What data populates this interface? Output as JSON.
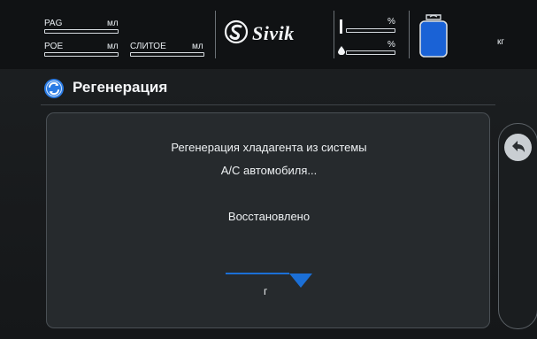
{
  "header": {
    "pag": {
      "label": "PAG",
      "unit": "мл"
    },
    "poe": {
      "label": "POE",
      "unit": "мл"
    },
    "drained": {
      "label": "СЛИТОЕ",
      "unit": "мл"
    },
    "brand": "Sivik",
    "level_top_unit": "%",
    "level_bottom_unit": "%",
    "weight_unit": "кг",
    "icons": {
      "brand_logo": "sivik-logo-icon",
      "drop": "drop-icon",
      "bottle": "refrigerant-bottle-icon"
    }
  },
  "title_bar": {
    "icon": "recovery-icon",
    "title": "Регенерация"
  },
  "panel": {
    "line1": "Регенерация хладагента из системы",
    "line2": "A/C автомобиля...",
    "status": "Восстановлено",
    "amount_unit": "г"
  },
  "side": {
    "back_icon": "back-arrow-icon"
  },
  "colors": {
    "accent": "#1b6fd6",
    "bottle_fill": "#1a62d6",
    "background": "#1d2022"
  }
}
